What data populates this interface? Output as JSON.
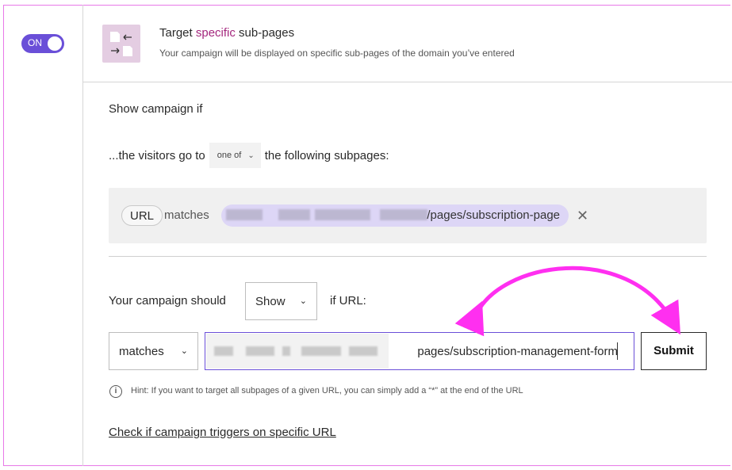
{
  "toggle": {
    "label": "ON",
    "state": "on"
  },
  "option": {
    "title_prefix": "Target ",
    "title_highlight": "specific",
    "title_suffix": " sub-pages",
    "description": "Your campaign will be displayed on specific sub-pages of the domain you’ve entered",
    "icon": "pages-swap-icon"
  },
  "show_campaign": {
    "heading": "Show campaign if",
    "visitors_prefix": "...the visitors go to",
    "condition_select": "one of",
    "visitors_suffix": "the following subpages:"
  },
  "rule": {
    "field": "URL",
    "operator": "matches",
    "value_visible": "/pages/subscription-page"
  },
  "form": {
    "should_label": "Your campaign should",
    "action_select": "Show",
    "if_url_label": "if URL:",
    "match_select": "matches",
    "url_value_visible": "pages/subscription-management-form",
    "submit_label": "Submit"
  },
  "hint": "Hint: If you want to target all subpages of a given URL, you can simply add a “*” at the end of the URL",
  "check_link": "Check if campaign triggers on specific URL",
  "colors": {
    "accent": "#6a4fd8",
    "highlight": "#a4287e",
    "annotation_arrow": "#ff2ff0"
  }
}
